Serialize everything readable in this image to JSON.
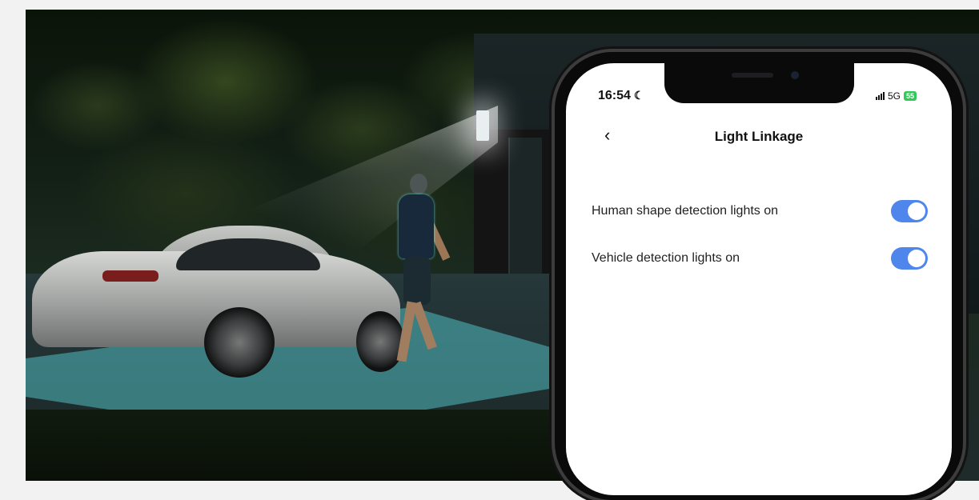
{
  "phone": {
    "status_bar": {
      "time": "16:54",
      "moon_icon": "☾",
      "network": "5G",
      "battery": "55"
    },
    "header": {
      "back_icon": "‹",
      "title": "Light Linkage"
    },
    "settings": [
      {
        "label": "Human shape detection lights on",
        "enabled": true
      },
      {
        "label": "Vehicle detection lights on",
        "enabled": true
      }
    ]
  },
  "colors": {
    "toggle_on": "#4f86ec",
    "detection_zone": "#5cdce1",
    "battery": "#34c759"
  }
}
